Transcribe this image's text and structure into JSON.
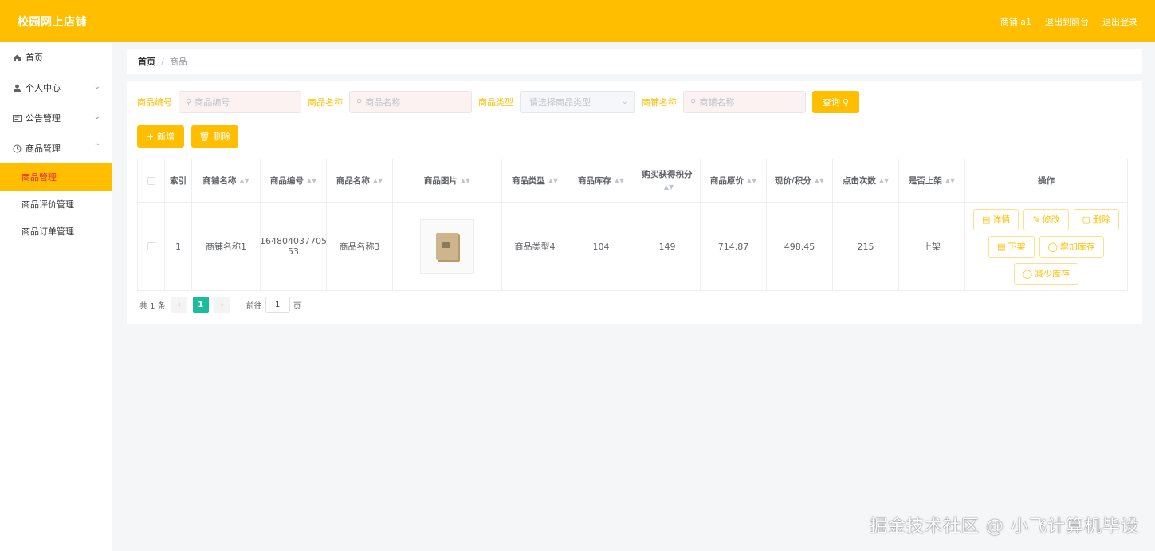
{
  "header": {
    "title": "校园网上店铺",
    "user": "商铺 a1",
    "back_front": "退出到前台",
    "logout": "退出登录"
  },
  "sidebar": {
    "items": [
      {
        "label": "首页",
        "icon": "home-icon"
      },
      {
        "label": "个人中心",
        "icon": "user-icon"
      },
      {
        "label": "公告管理",
        "icon": "notice-icon"
      },
      {
        "label": "商品管理",
        "icon": "goods-icon"
      }
    ],
    "subitems": [
      {
        "label": "商品管理",
        "active": true
      },
      {
        "label": "商品评价管理"
      },
      {
        "label": "商品订单管理"
      }
    ]
  },
  "breadcrumb": {
    "home": "首页",
    "current": "商品"
  },
  "search": {
    "code_label": "商品编号",
    "code_placeholder": "商品编号",
    "name_label": "商品名称",
    "name_placeholder": "商品名称",
    "type_label": "商品类型",
    "type_placeholder": "请选择商品类型",
    "shop_label": "商铺名称",
    "shop_placeholder": "商铺名称",
    "query_label": "查询"
  },
  "actions": {
    "add": "新增",
    "delete": "删除"
  },
  "table": {
    "headers": [
      "索引",
      "商铺名称",
      "商品编号",
      "商品名称",
      "商品图片",
      "商品类型",
      "商品库存",
      "购买获得积分",
      "商品原价",
      "现价/积分",
      "点击次数",
      "是否上架",
      "操作"
    ],
    "rows": [
      {
        "index": "1",
        "shop": "商铺名称1",
        "code": "164804037705 53",
        "name": "商品名称3",
        "type": "商品类型4",
        "stock": "104",
        "points": "149",
        "price": "714.87",
        "current": "498.45",
        "clicks": "215",
        "status": "上架"
      }
    ],
    "op_buttons": {
      "detail": "详情",
      "edit": "修改",
      "delete": "删除",
      "off": "下架",
      "add_stock": "增加库存",
      "reduce_stock": "减少库存"
    }
  },
  "pagination": {
    "total": "共 1 条",
    "current": "1",
    "goto_prefix": "前往",
    "goto_value": "1",
    "goto_suffix": "页"
  },
  "watermark": "掘金技术社区 @ 小飞计算机毕设",
  "colors": {
    "accent": "#ffbf00",
    "pager_active": "#1abc9c"
  }
}
